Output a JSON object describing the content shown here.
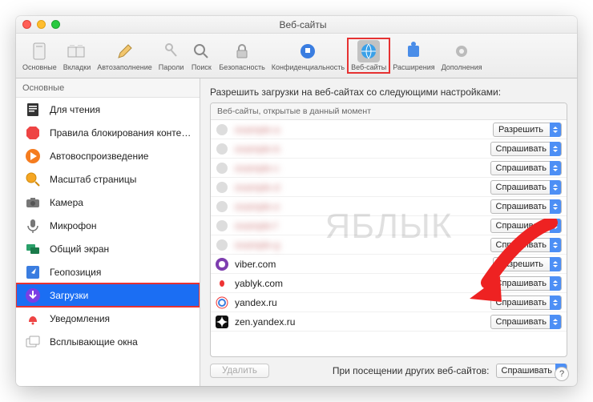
{
  "window": {
    "title": "Веб-сайты"
  },
  "toolbar": [
    {
      "label": "Основные"
    },
    {
      "label": "Вкладки"
    },
    {
      "label": "Автозаполнение"
    },
    {
      "label": "Пароли"
    },
    {
      "label": "Поиск"
    },
    {
      "label": "Безопасность"
    },
    {
      "label": "Конфиденциальность"
    },
    {
      "label": "Веб-сайты"
    },
    {
      "label": "Расширения"
    },
    {
      "label": "Дополнения"
    }
  ],
  "sidebar": {
    "header": "Основные",
    "items": [
      {
        "label": "Для чтения"
      },
      {
        "label": "Правила блокирования контента"
      },
      {
        "label": "Автовоспроизведение"
      },
      {
        "label": "Масштаб страницы"
      },
      {
        "label": "Камера"
      },
      {
        "label": "Микрофон"
      },
      {
        "label": "Общий экран"
      },
      {
        "label": "Геопозиция"
      },
      {
        "label": "Загрузки"
      },
      {
        "label": "Уведомления"
      },
      {
        "label": "Всплывающие окна"
      }
    ]
  },
  "main": {
    "heading": "Разрешить загрузки на веб-сайтах со следующими настройками:",
    "table_header": "Веб-сайты, открытые в данный момент",
    "rows": [
      {
        "domain": "example-a",
        "value": "Разрешить",
        "blur": true,
        "fav": "g"
      },
      {
        "domain": "example-b",
        "value": "Спрашивать",
        "blur": true,
        "fav": "g"
      },
      {
        "domain": "example-c",
        "value": "Спрашивать",
        "blur": true,
        "fav": "g"
      },
      {
        "domain": "example-d",
        "value": "Спрашивать",
        "blur": true,
        "fav": "g"
      },
      {
        "domain": "example-e",
        "value": "Спрашивать",
        "blur": true,
        "fav": "g"
      },
      {
        "domain": "example-f",
        "value": "Спрашивать",
        "blur": true,
        "fav": "g"
      },
      {
        "domain": "example-g",
        "value": "Спрашивать",
        "blur": true,
        "fav": "g"
      },
      {
        "domain": "viber.com",
        "value": "Разрешить",
        "blur": false,
        "fav": "viber"
      },
      {
        "domain": "yablyk.com",
        "value": "Спрашивать",
        "blur": false,
        "fav": "yablyk"
      },
      {
        "domain": "yandex.ru",
        "value": "Спрашивать",
        "blur": false,
        "fav": "yandex"
      },
      {
        "domain": "zen.yandex.ru",
        "value": "Спрашивать",
        "blur": false,
        "fav": "zen"
      }
    ],
    "delete_label": "Удалить",
    "footer_label": "При посещении других веб-сайтов:",
    "footer_value": "Спрашивать"
  },
  "watermark": "ЯБЛЫК",
  "help": "?"
}
